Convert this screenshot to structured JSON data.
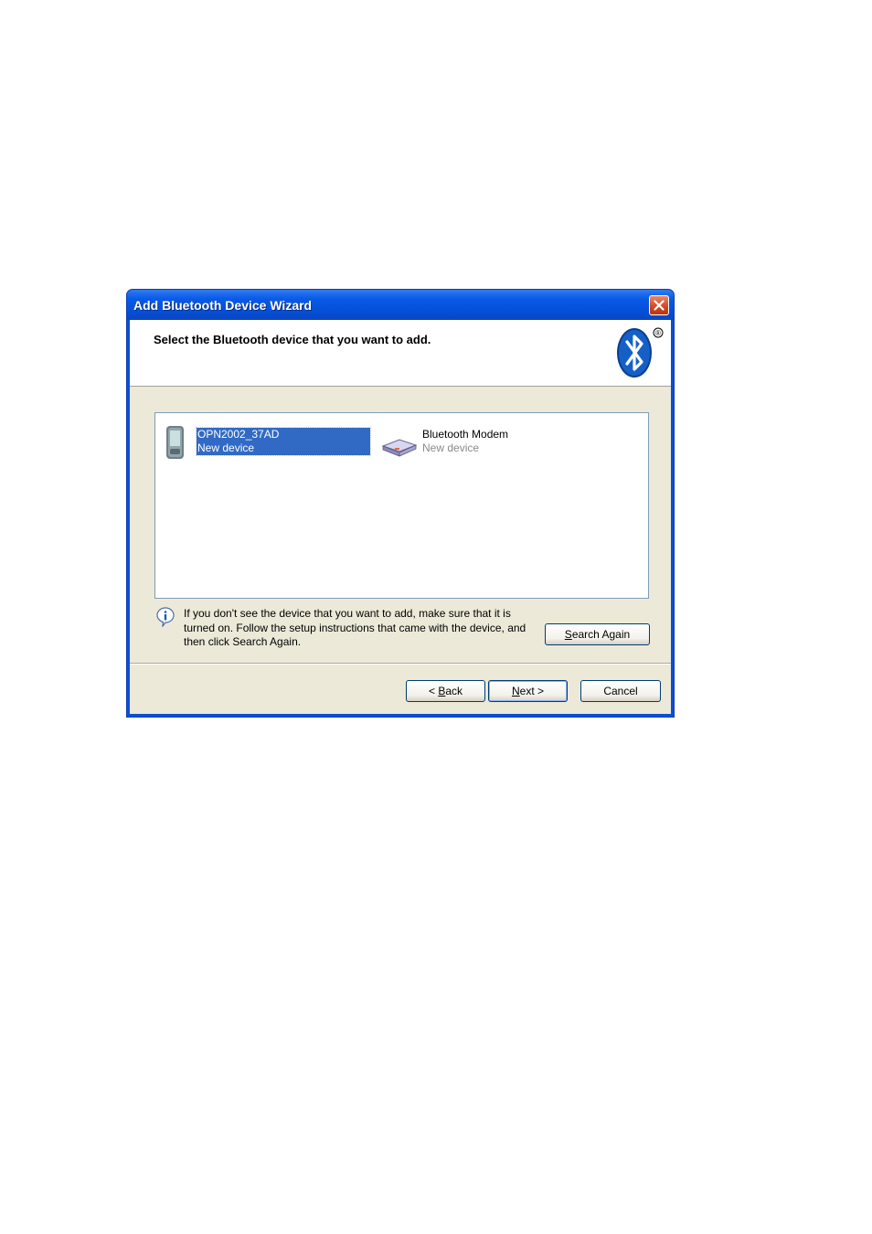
{
  "window": {
    "title": "Add Bluetooth Device Wizard",
    "close_icon": "close-icon"
  },
  "header": {
    "text": "Select the Bluetooth device that you want to add.",
    "logo": "bluetooth-logo-icon",
    "logo_mark": "®"
  },
  "devices": [
    {
      "name": "OPN2002_37AD",
      "status": "New device",
      "icon": "pda-icon",
      "selected": true
    },
    {
      "name": "Bluetooth Modem",
      "status": "New device",
      "icon": "modem-icon",
      "selected": false
    }
  ],
  "info": {
    "icon": "info-icon",
    "text": "If you don't see the device that you want to add, make sure that it is turned on. Follow the setup instructions that came with the device, and then click Search Again."
  },
  "buttons": {
    "search_again": {
      "prefix": "",
      "accel": "S",
      "rest": "earch Again"
    },
    "back": {
      "prefix": "< ",
      "accel": "B",
      "rest": "ack"
    },
    "next": {
      "prefix": "",
      "accel": "N",
      "rest": "ext >"
    },
    "cancel": "Cancel"
  },
  "colors": {
    "titlebar": "#0a5ae6",
    "selection": "#316ac5",
    "dialog_bg": "#ece9d8",
    "close_button": "#d2451f"
  }
}
